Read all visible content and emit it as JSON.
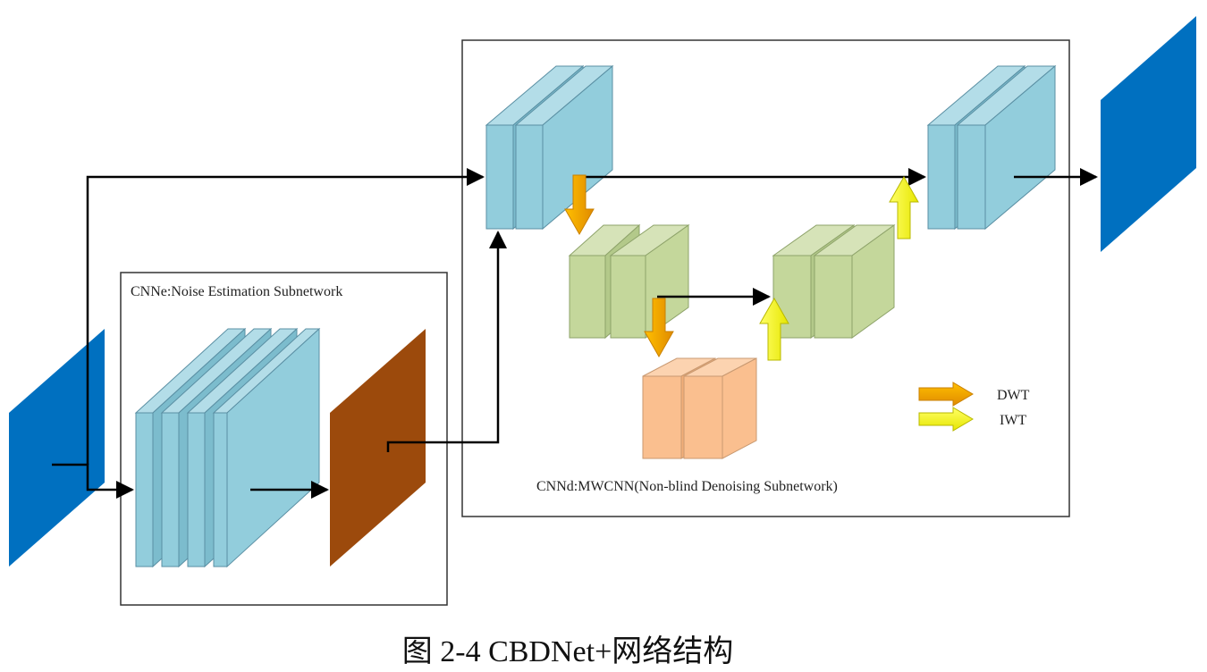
{
  "noise_estimation": {
    "label": "CNNe:Noise Estimation Subnetwork"
  },
  "denoising": {
    "label": "CNNd:MWCNN(Non-blind Denoising Subnetwork)"
  },
  "legend": {
    "dwt_label": "DWT",
    "iwt_label": "IWT"
  },
  "caption": "图 2-4 CBDNet+网络结构",
  "colors": {
    "image_blue": "#0070C0",
    "noise_map_brown": "#9C4A0C",
    "feature_cyan": "#92CDDC",
    "feature_green": "#C4D79B",
    "feature_peach": "#FABF8F",
    "dwt_orange": "#F4A100",
    "iwt_yellow": "#FFFF00"
  }
}
